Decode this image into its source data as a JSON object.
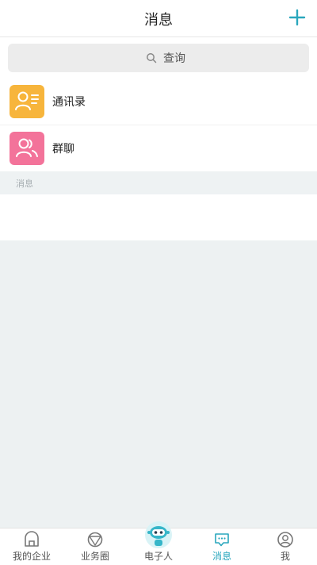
{
  "header": {
    "title": "消息",
    "add_icon": "plus-icon"
  },
  "search": {
    "placeholder": "查询",
    "icon": "search-icon"
  },
  "entries": [
    {
      "label": "通讯录",
      "icon": "contacts-icon",
      "color": "#f7b53c"
    },
    {
      "label": "群聊",
      "icon": "group-icon",
      "color": "#f3739a"
    }
  ],
  "section": {
    "title": "消息"
  },
  "tabs": [
    {
      "label": "我的企业",
      "icon": "home-icon",
      "active": false
    },
    {
      "label": "业务圈",
      "icon": "circle-icon",
      "active": false
    },
    {
      "label": "电子人",
      "icon": "robot-icon",
      "active": false
    },
    {
      "label": "消息",
      "icon": "message-icon",
      "active": true
    },
    {
      "label": "我",
      "icon": "profile-icon",
      "active": false
    }
  ],
  "colors": {
    "accent": "#2aa7bd",
    "background": "#edf1f2"
  }
}
